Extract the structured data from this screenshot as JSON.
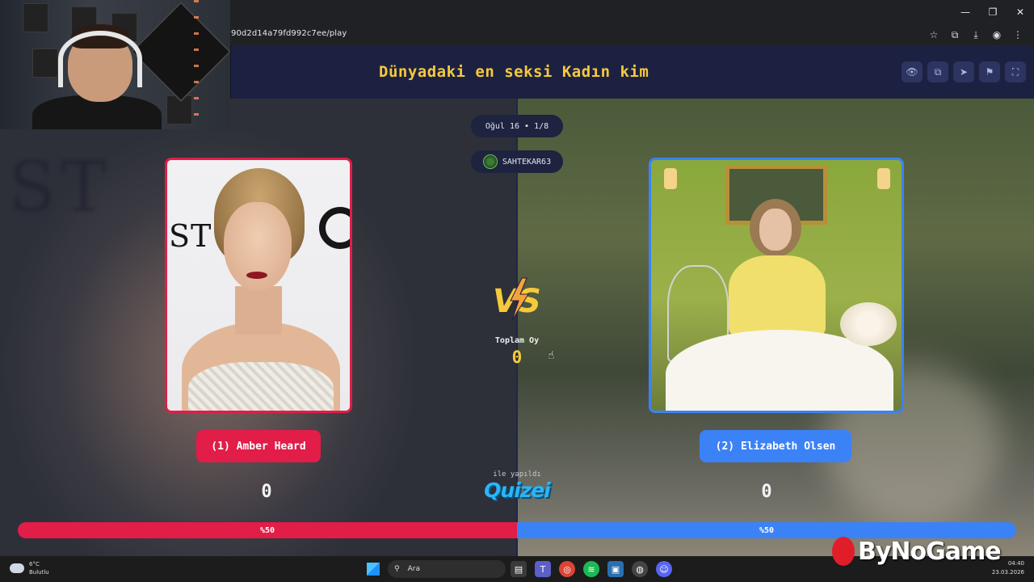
{
  "browser": {
    "url": "90d2d14a79fd992c7ee/play",
    "controls": [
      "—",
      "❐",
      "✕"
    ],
    "icons": [
      "star-icon",
      "translate-icon",
      "download-icon",
      "profile-icon",
      "menu-icon"
    ]
  },
  "quiz": {
    "title": "Dünyadaki en seksi Kadın kim",
    "round_info": "Oğul 16 • 1/8",
    "username": "SAHTEKAR63",
    "tools": [
      "eye-icon",
      "copy-icon",
      "send-icon",
      "flag-icon",
      "fullscreen-icon"
    ]
  },
  "left": {
    "name": "(1) Amber Heard",
    "score": "0",
    "percent_label": "%50",
    "vote_share": 0.5,
    "backdrop_text": "ST",
    "color": "#e11d48"
  },
  "right": {
    "name": "(2) Elizabeth Olsen",
    "score": "0",
    "percent_label": "%50",
    "vote_share": 0.5,
    "color": "#3b82f6"
  },
  "center": {
    "vs_text": "VS",
    "total_label": "Toplam Oy",
    "total_value": "0",
    "made_with": "ile yapıldı",
    "brand": "Quizei"
  },
  "taskbar": {
    "temperature": "6°C",
    "weather": "Bulutlu",
    "search_placeholder": "Ara",
    "time": "04:40",
    "date": "23.03.2026"
  },
  "watermark": "ByNoGame",
  "colors": {
    "accent_yellow": "#f6c93c",
    "header_bg": "#1d2141",
    "brand_cyan": "#29b6f6"
  }
}
